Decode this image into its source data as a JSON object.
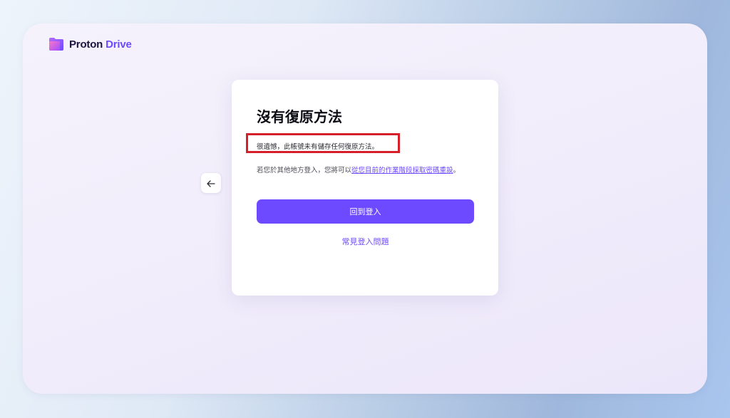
{
  "brand": {
    "name_part1": "Proton",
    "name_part2": "Drive",
    "logo_icon": "proton-drive-folder-icon"
  },
  "navigation": {
    "back_icon": "arrow-left-icon"
  },
  "card": {
    "title": "沒有復原方法",
    "message": "很遺憾，此帳號未有儲存任何復原方法。",
    "info_prefix": "若您於其他地方登入，您將可以",
    "info_link": "從您目前的作業階段採取密碼重設",
    "info_suffix": "。",
    "primary_button": "回到登入",
    "help_link": "常見登入問題"
  },
  "colors": {
    "accent": "#6d4aff",
    "highlight_border": "#d51f2b",
    "title": "#0c0c14"
  }
}
